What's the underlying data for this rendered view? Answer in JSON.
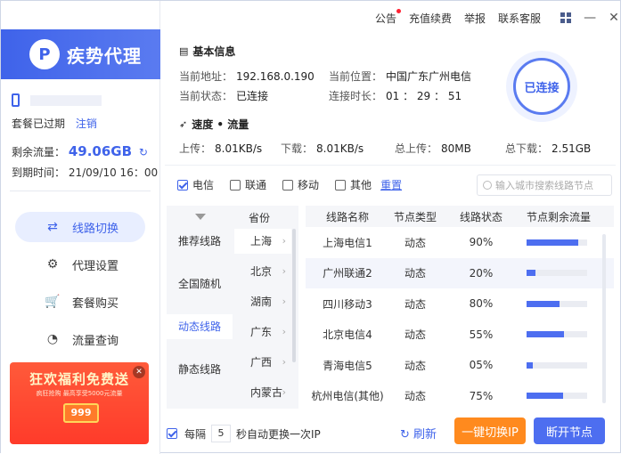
{
  "app": {
    "name": "疾势代理",
    "logo_letter": "P"
  },
  "topbar": {
    "announce": "公告",
    "recharge": "充值续费",
    "report": "举报",
    "support": "联系客服",
    "minimize": "—",
    "close": "✕"
  },
  "account": {
    "expired_label": "套餐已过期",
    "logout": "注销",
    "traffic_label": "剩余流量：",
    "traffic_value": "49.06GB",
    "expiry_label": "到期时间：",
    "expiry_value": "21/09/10 16：00"
  },
  "nav": [
    {
      "label": "线路切换",
      "icon": "⇄"
    },
    {
      "label": "代理设置",
      "icon": "⚙"
    },
    {
      "label": "套餐购买",
      "icon": "🛒"
    },
    {
      "label": "流量查询",
      "icon": "◔"
    }
  ],
  "promo": {
    "title": "狂欢福利免费送",
    "subtitle": "疯狂抢购 最高享受5000元流量",
    "badge": "999",
    "close": "✕"
  },
  "basic": {
    "title": "基本信息",
    "addr_label": "当前地址：",
    "addr_value": "192.168.0.190",
    "loc_label": "当前位置：",
    "loc_value": "中国广东广州电信",
    "state_label": "当前状态：",
    "state_value": "已连接",
    "dur_label": "连接时长：",
    "dur_value": "01 ： 29 ： 51"
  },
  "speed": {
    "title": "速度 • 流量",
    "up_label": "上传：",
    "up_value": "8.01KB/s",
    "down_label": "下载：",
    "down_value": "8.01KB/s",
    "total_up_label": "总上传：",
    "total_up_value": "80MB",
    "total_down_label": "总下载：",
    "total_down_value": "2.51GB"
  },
  "connect_button": "已连接",
  "filters": {
    "options": [
      {
        "label": "电信",
        "checked": true
      },
      {
        "label": "联通",
        "checked": false
      },
      {
        "label": "移动",
        "checked": false
      },
      {
        "label": "其他",
        "checked": false
      }
    ],
    "reset": "重置",
    "search_placeholder": "输入城市搜索线路节点"
  },
  "categories": {
    "province_header": "省份",
    "items": [
      "推荐线路",
      "全国随机",
      "动态线路",
      "静态线路"
    ],
    "active": "动态线路",
    "provinces": [
      "上海",
      "北京",
      "湖南",
      "广东",
      "广西",
      "内蒙古"
    ]
  },
  "table": {
    "headers": [
      "线路名称",
      "节点类型",
      "线路状态",
      "节点剩余流量"
    ],
    "rows": [
      {
        "name": "上海电信1",
        "type": "动态",
        "status": "90%",
        "remaining": 0.85
      },
      {
        "name": "广州联通2",
        "type": "动态",
        "status": "20%",
        "remaining": 0.15
      },
      {
        "name": "四川移动3",
        "type": "动态",
        "status": "80%",
        "remaining": 0.55
      },
      {
        "name": "北京电信4",
        "type": "动态",
        "status": "55%",
        "remaining": 0.62
      },
      {
        "name": "青海电信5",
        "type": "动态",
        "status": "05%",
        "remaining": 0.1
      },
      {
        "name": "杭州电信(其他)",
        "type": "动态",
        "status": "75%",
        "remaining": 0.6
      }
    ]
  },
  "footer": {
    "auto_prefix": "每隔",
    "auto_value": "5",
    "auto_suffix": "秒自动更换一次IP",
    "refresh": "刷新",
    "switch_ip": "一键切换IP",
    "disconnect": "断开节点"
  },
  "colors": {
    "accent": "#3f63ea",
    "orange": "#ff8a1e",
    "promo_red": "#ff4030"
  }
}
